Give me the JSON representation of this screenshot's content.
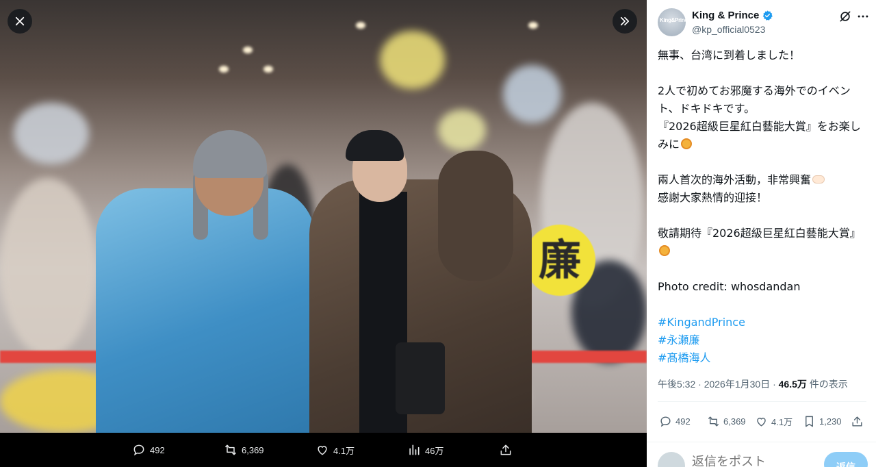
{
  "viewer": {
    "close_icon": "close-icon",
    "expand_icon": "double-chevron-right-icon",
    "sign_text": "廉",
    "bar": {
      "replies": "492",
      "reposts": "6,369",
      "likes": "4.1万",
      "views": "46万"
    }
  },
  "tweet": {
    "display_name": "King & Prince",
    "handle": "@kp_official0523",
    "avatar_text": "King&Prince",
    "verified": true,
    "verified_color": "#1d9bf0",
    "paragraphs": [
      "無事、台湾に到着しました！",
      "2人で初めてお邪魔する海外でのイベント、ドキドキです。",
      "『2026超級巨星紅白藝能大賞』をお楽しみに",
      "兩人首次的海外活動，非常興奮",
      "感謝大家熱情的迎接！",
      "敬請期待『2026超級巨星紅白藝能大賞』",
      "Photo credit: whosdandan"
    ],
    "hashtags": [
      "#KingandPrince",
      "#永瀬廉",
      "#髙橋海人"
    ],
    "time": "午後5:32 · 2026年1月30日 · ",
    "views_count": "46.5万",
    "views_label": " 件の表示",
    "actions": {
      "replies": "492",
      "reposts": "6,369",
      "likes": "4.1万",
      "bookmarks": "1,230"
    },
    "reply_placeholder": "返信をポスト",
    "reply_button": "返信"
  },
  "colors": {
    "accent": "#1d9bf0",
    "secondary_text": "#536471"
  }
}
